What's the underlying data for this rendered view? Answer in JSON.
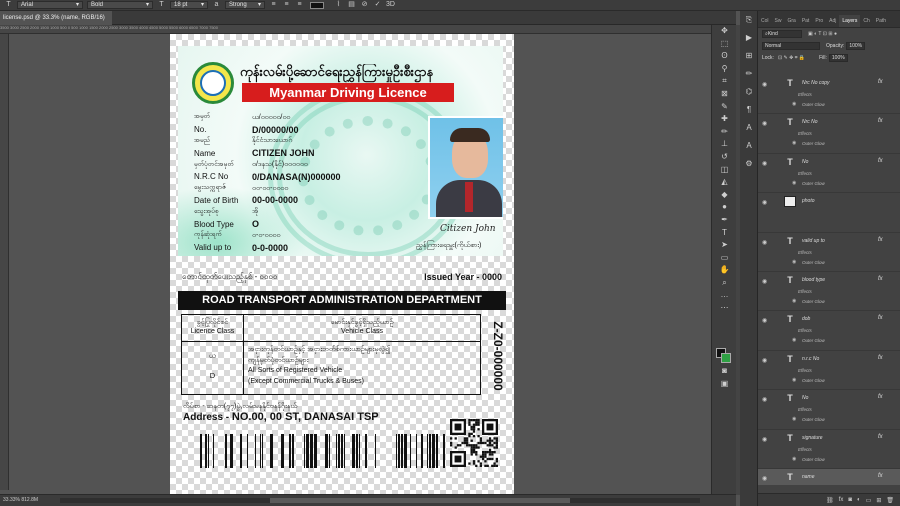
{
  "options_bar": {
    "font_family": "Arial",
    "font_style": "Bold",
    "font_size": "18 pt",
    "anti_alias": "Strong"
  },
  "document": {
    "tab_title": "license.psd @ 33.3% (name, RGB/16) *",
    "tab_close": "×",
    "ruler_text": "3500  3000  2500  2000  1500  1000  500  0  500  1000  1500  2000  2500  3000  3500  4000  4500  5000  5500  6000  6500  7000  7500"
  },
  "card_front": {
    "myanmar_title": "ကုန်းလမ်းပို့ဆောင်ရေးညွှန်ကြားမှုဦးစီးဌာန",
    "title": "Myanmar Driving Licence",
    "fields": [
      {
        "label_mm": "အမှတ်",
        "label": "No.",
        "value_mm": "ယ/၀၀၀၀၀/၀၀",
        "value": "D/00000/00"
      },
      {
        "label_mm": "အမည်",
        "label": "Name",
        "value_mm": "နိုင်ငံသားယောဂ်",
        "value": "CITIZEN JOHN"
      },
      {
        "label_mm": "မှတ်ပုံတင်အမှတ်",
        "label": "N.R.C No",
        "value_mm": "၀/ဒနသ(နိုင်)၀၀၀၀၀၀",
        "value": "0/DANASA(N)000000"
      },
      {
        "label_mm": "မွေးသက္ကရာဇ်",
        "label": "Date of Birth",
        "value_mm": "၀၀-၀၀-၀၀၀၀",
        "value": "00-00-0000"
      },
      {
        "label_mm": "သွေးအုပ်စု",
        "label": "Blood Type",
        "value_mm": "အို",
        "value": "O"
      },
      {
        "label_mm": "ကုန်ဆုံးရက်",
        "label": "Valid up to",
        "value_mm": "၀-၀-၀၀၀၀",
        "value": "0-0-0000"
      }
    ],
    "signature": "Citizen John",
    "holder_mm": "ညွှန်ကြားရေးမှူး(ကိုယ်စား)"
  },
  "card_back": {
    "serial_mm": "တောင်ထုတ်ပေးသည့်နှစ် - ၀၀၀၀",
    "issued_year": "Issued Year - 0000",
    "department": "ROAD TRANSPORT ADMINISTRATION DEPARTMENT",
    "class_head_mm": "ခွင့်ပြုလိုင်စင်",
    "class_head": "Licence Class",
    "vehicle_head_mm": "မောင်းနှင်ခွင့်ရှိသည့်ယာဉ်",
    "vehicle_head": "Vehicle Class",
    "class_mm": "ယ",
    "class": "D",
    "vehicle_mm_1": "အငှားကုန်တင်ယာဉ်နှင့် အငှားဘတ်စ်ကားယာဉ်များမှလွဲ၍",
    "vehicle_mm_2": "ကျန်မှတ်ပုံတင်ယာဉ်များ",
    "vehicle_1": "All Sorts of Registered Vehicle",
    "vehicle_2": "(Except Commercial Trucks & Buses)",
    "vertical_code": "Z-Z0-000000",
    "address_mm": "လိပ်စာ    - ဆနတ(၇၇)ပွဲ,လမ်းမနနိုင်ဗနန်ဂိုးနယ်",
    "address_label": "Address -",
    "address": "NO.00, 00 ST, DANASAI TSP"
  },
  "layers_panel": {
    "tabs": [
      "Col",
      "Sw",
      "Gra",
      "Pat",
      "Pro",
      "Adj",
      "Layers",
      "Ch",
      "Path"
    ],
    "active_tab": "Layers",
    "filter": "Kind",
    "blend_mode": "Normal",
    "opacity_label": "Opacity:",
    "opacity": "100%",
    "lock_label": "Lock:",
    "fill_label": "Fill:",
    "fill": "100%",
    "effects_label": "Effects",
    "outer_glow_label": "Outer Glow",
    "layers": [
      {
        "name": "Nrc No copy",
        "type": "text"
      },
      {
        "name": "Nrc No",
        "type": "text"
      },
      {
        "name": "No",
        "type": "text"
      },
      {
        "name": "photo",
        "type": "image"
      },
      {
        "name": "valid up to",
        "type": "text"
      },
      {
        "name": "blood type",
        "type": "text"
      },
      {
        "name": "dob",
        "type": "text"
      },
      {
        "name": "n.r.c No",
        "type": "text"
      },
      {
        "name": "No",
        "type": "text"
      },
      {
        "name": "signature",
        "type": "text"
      },
      {
        "name": "name",
        "type": "text",
        "selected": true
      }
    ]
  },
  "status_bar": {
    "zoom_info": "33.33%   812.8M"
  }
}
